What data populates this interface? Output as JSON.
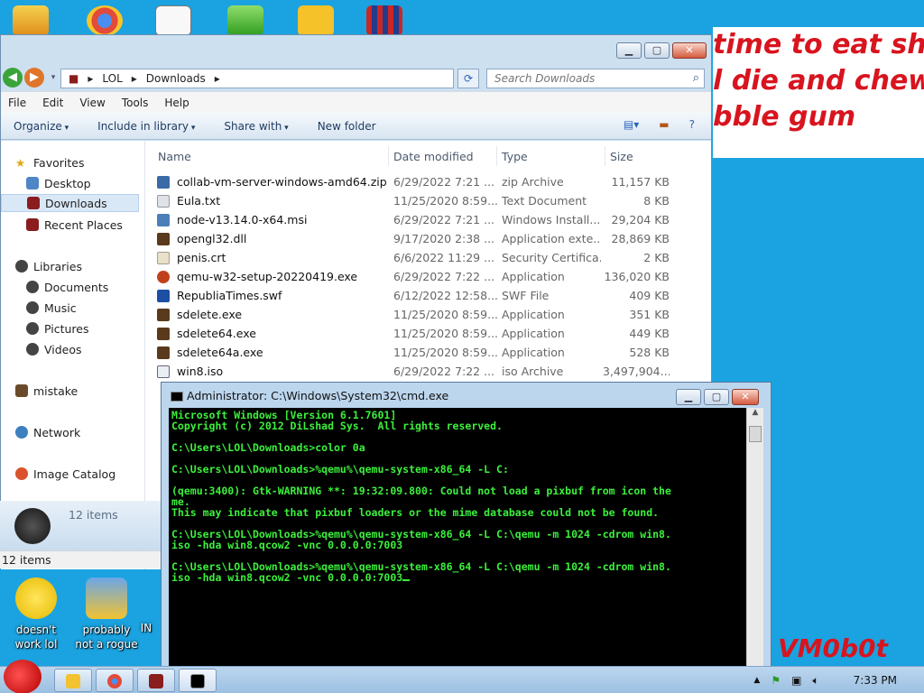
{
  "wallpaper": {
    "banner_lines": [
      "time to eat shit",
      "l die and chew",
      "bble gum"
    ],
    "watermark": "VM0b0t"
  },
  "desktop_icons": [
    {
      "label_lines": [
        "doesn't",
        "work lol"
      ],
      "name": "yahoo-messenger"
    },
    {
      "label_lines": [
        "probably",
        "not a rogue"
      ],
      "name": "settings-app"
    },
    {
      "label_lines": [
        "IN"
      ],
      "name": "partial-icon"
    }
  ],
  "top_icons": [
    "folder-icon",
    "chrome-icon",
    "cards-icon",
    "security-shield-icon",
    "angry-birds-pig-icon",
    "flag-icon"
  ],
  "explorer": {
    "address": {
      "segments": [
        "LOL",
        "Downloads"
      ]
    },
    "search_placeholder": "Search Downloads",
    "menu": [
      "File",
      "Edit",
      "View",
      "Tools",
      "Help"
    ],
    "commands": [
      "Organize",
      "Include in library",
      "Share with",
      "New folder"
    ],
    "columns": [
      "Name",
      "Date modified",
      "Type",
      "Size"
    ],
    "nav": {
      "favorites": "Favorites",
      "desktop": "Desktop",
      "downloads": "Downloads",
      "recent": "Recent Places",
      "libraries": "Libraries",
      "documents": "Documents",
      "music": "Music",
      "pictures": "Pictures",
      "videos": "Videos",
      "mistake": "mistake",
      "network": "Network",
      "image_catalog": "Image Catalog"
    },
    "files": [
      {
        "name": "collab-vm-server-windows-amd64.zip",
        "date": "6/29/2022 7:21 ...",
        "type": "zip Archive",
        "size": "11,157 KB"
      },
      {
        "name": "Eula.txt",
        "date": "11/25/2020 8:59...",
        "type": "Text Document",
        "size": "8 KB"
      },
      {
        "name": "node-v13.14.0-x64.msi",
        "date": "6/29/2022 7:21 ...",
        "type": "Windows Install...",
        "size": "29,204 KB"
      },
      {
        "name": "opengl32.dll",
        "date": "9/17/2020 2:38 ...",
        "type": "Application exte...",
        "size": "28,869 KB"
      },
      {
        "name": "penis.crt",
        "date": "6/6/2022 11:29 ...",
        "type": "Security Certifica...",
        "size": "2 KB"
      },
      {
        "name": "qemu-w32-setup-20220419.exe",
        "date": "6/29/2022 7:22 ...",
        "type": "Application",
        "size": "136,020 KB"
      },
      {
        "name": "RepubliaTimes.swf",
        "date": "6/12/2022 12:58...",
        "type": "SWF File",
        "size": "409 KB"
      },
      {
        "name": "sdelete.exe",
        "date": "11/25/2020 8:59...",
        "type": "Application",
        "size": "351 KB"
      },
      {
        "name": "sdelete64.exe",
        "date": "11/25/2020 8:59...",
        "type": "Application",
        "size": "449 KB"
      },
      {
        "name": "sdelete64a.exe",
        "date": "11/25/2020 8:59...",
        "type": "Application",
        "size": "528 KB"
      },
      {
        "name": "win8.iso",
        "date": "6/29/2022 7:22 ...",
        "type": "iso Archive",
        "size": "3,497,904..."
      }
    ],
    "details_count": "12 items",
    "status_count": "12 items"
  },
  "cmd": {
    "title": "Administrator: C:\\Windows\\System32\\cmd.exe",
    "lines": [
      "Microsoft Windows [Version 6.1.7601]",
      "Copyright (c) 2012 DiLshad Sys.  All rights reserved.",
      "",
      "C:\\Users\\LOL\\Downloads>color 0a",
      "",
      "C:\\Users\\LOL\\Downloads>%qemu%\\qemu-system-x86_64 -L C:",
      "",
      "(qemu:3400): Gtk-WARNING **: 19:32:09.800: Could not load a pixbuf from icon the",
      "me.",
      "This may indicate that pixbuf loaders or the mime database could not be found.",
      "",
      "C:\\Users\\LOL\\Downloads>%qemu%\\qemu-system-x86_64 -L C:\\qemu -m 1024 -cdrom win8.",
      "iso -hda win8.qcow2 -vnc 0.0.0.0:7003",
      "",
      "C:\\Users\\LOL\\Downloads>%qemu%\\qemu-system-x86_64 -L C:\\qemu -m 1024 -cdrom win8.",
      "iso -hda win8.qcow2 -vnc 0.0.0.0:7003"
    ]
  },
  "taskbar": {
    "clock": "7:33 PM",
    "tray_arrow": "▲"
  },
  "colors": {
    "cmd_text": "#3cf03c",
    "desktop": "#1aa3e0",
    "banner_text": "#d8141e"
  }
}
